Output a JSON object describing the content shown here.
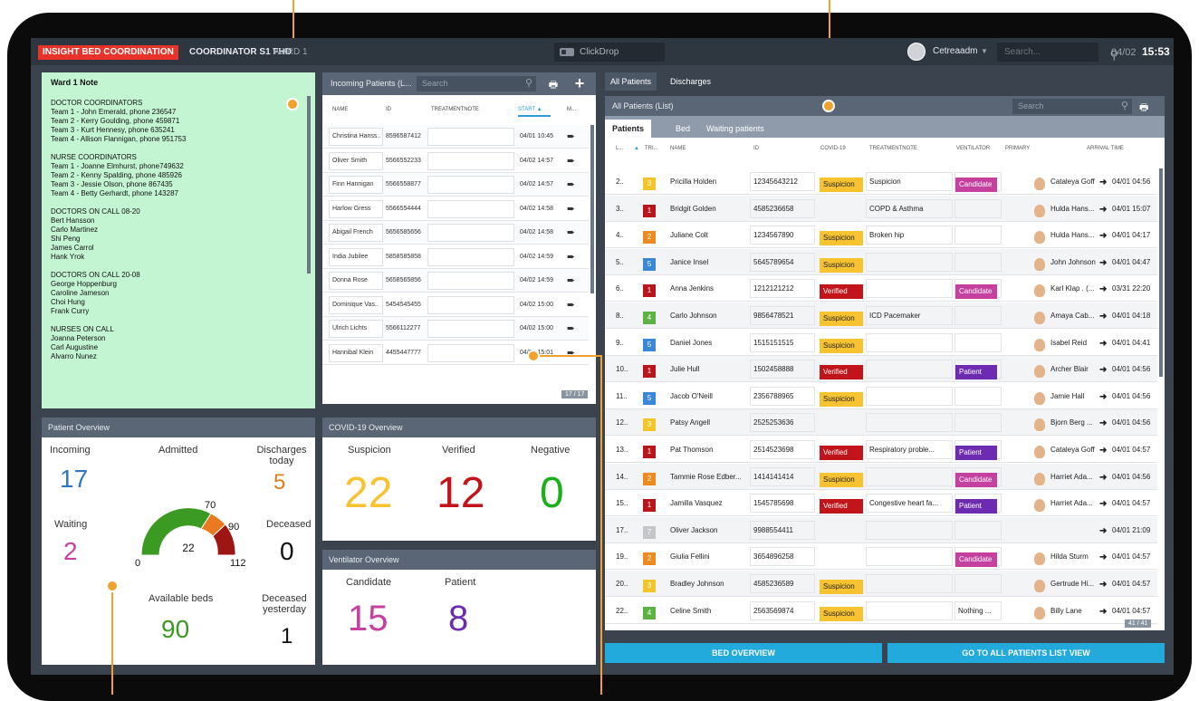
{
  "topbar": {
    "brand": "INSIGHT BED COORDINATION",
    "role": "COORDINATOR S1 FHD",
    "ward": "WARD 1",
    "clickdrop": "ClickDrop",
    "user": "Cetreaadm",
    "search_placeholder": "Search...",
    "date": "04/02",
    "time": "15:53"
  },
  "note": {
    "title": "Ward 1 Note",
    "sections": [
      [
        "DOCTOR COORDINATORS",
        "Team 1 - John Emerald, phone 236547",
        "Team 2 - Kerry Goulding, phone 459871",
        "Team 3 - Kurt Hennesy, phone 635241",
        "Team 4 - Allison Flannigan, phone 951753"
      ],
      [
        "NURSE COORDINATORS",
        "Team 1 - Joanne Elmhurst, phone749632",
        "Team 2 - Kenny Spalding, phone 485926",
        "Team 3 - Jessie Olson, phone 867435",
        "Team 4 - Betty Gerhardt, phone  143287"
      ],
      [
        "DOCTORS ON CALL 08-20",
        "Bert Hansson",
        "Carlo Martinez",
        "Shi Peng",
        "James Carrol",
        "Hank Yrok"
      ],
      [
        "DOCTORS ON CALL 20-08",
        "George Hoppenburg",
        "Caroline Jameson",
        "Choi Hung",
        "Frank Curry"
      ],
      [
        "NURSES ON CALL",
        "Joanna Peterson",
        "Carl Augustine",
        "Alvarro Nunez"
      ]
    ]
  },
  "incoming": {
    "title": "Incoming Patients (L...",
    "search": "Search",
    "columns": [
      "NAME",
      "ID",
      "TREATMENTNOTE",
      "START",
      "M..."
    ],
    "count": "17 / 17",
    "rows": [
      [
        "Christina Hanss..",
        "8596587412",
        "04/01 10:45"
      ],
      [
        "Oliver Smith",
        "5566552233",
        "04/02 14:57"
      ],
      [
        "Finn Hannigan",
        "5566558877",
        "04/02 14:57"
      ],
      [
        "Harlow Gress",
        "5566554444",
        "04/02 14:58"
      ],
      [
        "Abigail French",
        "5656585656",
        "04/02 14:58"
      ],
      [
        "India Jubilee",
        "5858585858",
        "04/02 14:59"
      ],
      [
        "Donna Rose",
        "5658565856",
        "04/02 14:59"
      ],
      [
        "Dominique Vas..",
        "5454545455",
        "04/02 15:00"
      ],
      [
        "Ulrich Lichts",
        "5566112277",
        "04/02 15:00"
      ],
      [
        "Hannibal Klein",
        "4455447777",
        "04/02 15:01"
      ]
    ]
  },
  "overview": {
    "title": "Patient Overview",
    "incoming_label": "Incoming",
    "incoming": "17",
    "admitted_label": "Admitted",
    "discharges_label": "Discharges today",
    "discharges": "5",
    "waiting_label": "Waiting",
    "waiting": "2",
    "deceased_label": "Deceased",
    "deceased": "0",
    "available_label": "Available beds",
    "available": "90",
    "deceased_y_label": "Deceased yesterday",
    "deceased_y": "1",
    "gauge": {
      "value": "22",
      "min": "0",
      "t1": "70",
      "t2": "90",
      "max": "112"
    }
  },
  "covid": {
    "title": "COVID-19 Overview",
    "suspicion_label": "Suspicion",
    "suspicion": "22",
    "verified_label": "Verified",
    "verified": "12",
    "negative_label": "Negative",
    "negative": "0"
  },
  "vent": {
    "title": "Ventilator Overview",
    "candidate_label": "Candidate",
    "candidate": "15",
    "patient_label": "Patient",
    "patient": "8"
  },
  "patients": {
    "tab_all": "All Patients",
    "tab_discharges": "Discharges",
    "list_title": "All Patients (List)",
    "search": "Search",
    "sub_patients": "Patients",
    "sub_bed": "Bed",
    "sub_waiting": "Waiting patients",
    "columns": [
      "L...",
      "TRI...",
      "NAME",
      "ID",
      "COVID-19",
      "TREATMENTNOTE",
      "VENTILATOR",
      "PRIMARY",
      "ARRIVAL TIME"
    ],
    "count": "41 / 41",
    "rows": [
      [
        "2..",
        "3",
        "Pricilla Holden",
        "12345643212",
        "Suspicion",
        "Suspicion",
        "Candidate",
        "Cataleya Goff",
        "04/01 04:56"
      ],
      [
        "3..",
        "1",
        "Bridgit Golden",
        "4585236658",
        "",
        "COPD & Asthma",
        "",
        "Hulda Hans...",
        "04/01 15:07"
      ],
      [
        "4..",
        "2",
        "Juliane Colt",
        "1234567890",
        "Suspicion",
        "Broken hip",
        "",
        "Hulda Hans...",
        "04/01 04:17"
      ],
      [
        "5..",
        "5",
        "Janice Insel",
        "5645789654",
        "Suspicion",
        "",
        "",
        "John Johnson",
        "04/01 04:47"
      ],
      [
        "6..",
        "1",
        "Anna Jenkins",
        "1212121212",
        "Verified",
        "",
        "Candidate",
        "Karl Klap . (...",
        "03/31 22:20"
      ],
      [
        "8..",
        "4",
        "Carlo Johnson",
        "9856478521",
        "Suspicion",
        "ICD Pacemaker",
        "",
        "Amaya Cab...",
        "04/01 04:18"
      ],
      [
        "9..",
        "5",
        "Daniel Jones",
        "1515151515",
        "Suspicion",
        "",
        "",
        "Isabel Reid",
        "04/01 04:41"
      ],
      [
        "10..",
        "1",
        "Julie Hull",
        "1502458888",
        "Verified",
        "",
        "Patient",
        "Archer Blair",
        "04/01 04:56"
      ],
      [
        "11..",
        "5",
        "Jacob O'Neill",
        "2356788965",
        "Suspicion",
        "",
        "",
        "Jamie Hall",
        "04/01 04:56"
      ],
      [
        "12..",
        "3",
        "Patsy Angell",
        "2525253636",
        "",
        "",
        "",
        "Bjorn Berg ...",
        "04/01 04:56"
      ],
      [
        "13..",
        "1",
        "Pat Thomson",
        "2514523698",
        "Verified",
        "Respiratory proble...",
        "Patient",
        "Cataleya Goff",
        "04/01 04:57"
      ],
      [
        "14..",
        "2",
        "Tammie Rose Edber...",
        "1414141414",
        "Suspicion",
        "",
        "Candidate",
        "Harriet Ada...",
        "04/01 04:56"
      ],
      [
        "15..",
        "1",
        "Jamilla Vasquez",
        "1545785698",
        "Verified",
        "Congestive heart fa...",
        "Patient",
        "Harriet Ada...",
        "04/01 04:57"
      ],
      [
        "17..",
        "7",
        "Oliver Jackson",
        "9988554411",
        "",
        "",
        "",
        "",
        "04/01 21:09"
      ],
      [
        "19..",
        "2",
        "Giulia Fellini",
        "3654896258",
        "",
        "",
        "Candidate",
        "Hilda Sturm",
        "04/01 04:57"
      ],
      [
        "20..",
        "3",
        "Bradley Johnson",
        "4585236589",
        "Suspicion",
        "",
        "",
        "Gertrude Hi...",
        "04/01 04:57"
      ],
      [
        "22..",
        "4",
        "Celine Smith",
        "2563569874",
        "Suspicion",
        "",
        "Nothing ...",
        "Billy Lane",
        "04/01 04:57"
      ]
    ]
  },
  "buttons": {
    "bed_overview": "BED OVERVIEW",
    "all_patients": "GO TO ALL PATIENTS LIST VIEW"
  },
  "colors": {
    "brand_red": "#e8332a",
    "accent_blue": "#21aadb",
    "note_green": "#c3f5d3",
    "callout": "#f2a22c",
    "suspicion": "#f7c331",
    "verified": "#c2141b",
    "candidate": "#c6409f",
    "patient": "#6c2bb0",
    "tri1": "#b8161b",
    "tri2": "#ee8a1f",
    "tri3": "#f4c52a",
    "tri4": "#5cb344",
    "tri5": "#3a87d8",
    "tri7": "#c4c6ca"
  }
}
